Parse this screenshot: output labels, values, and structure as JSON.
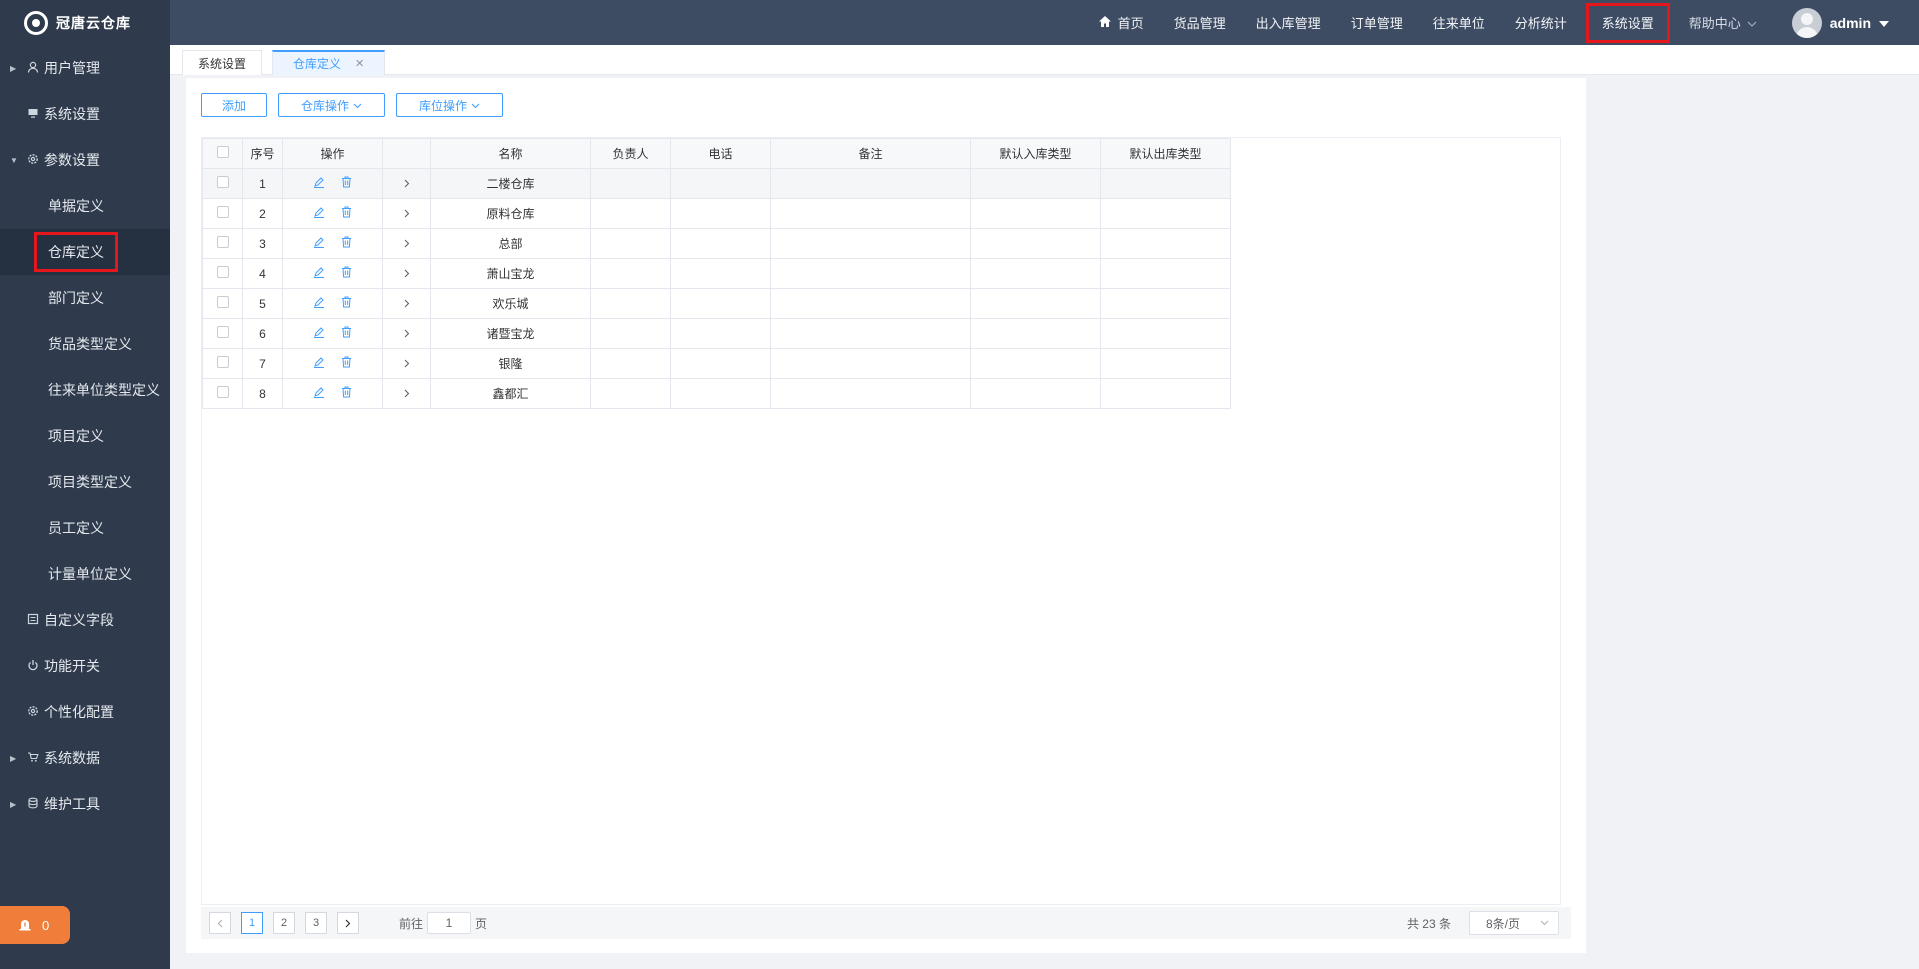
{
  "app": {
    "logo_text": "冠唐云仓库"
  },
  "sidebar": {
    "items": [
      {
        "label": "用户管理",
        "icon": "user-icon",
        "arrow": "collapsed"
      },
      {
        "label": "系统设置",
        "icon": "monitor-icon"
      },
      {
        "label": "参数设置",
        "icon": "gear-icon",
        "arrow": "expanded"
      },
      {
        "label": "单据定义"
      },
      {
        "label": "仓库定义",
        "active": true
      },
      {
        "label": "部门定义"
      },
      {
        "label": "货品类型定义"
      },
      {
        "label": "往来单位类型定义"
      },
      {
        "label": "项目定义"
      },
      {
        "label": "项目类型定义"
      },
      {
        "label": "员工定义"
      },
      {
        "label": "计量单位定义"
      },
      {
        "label": "自定义字段",
        "icon": "form-icon"
      },
      {
        "label": "功能开关",
        "icon": "power-icon"
      },
      {
        "label": "个性化配置",
        "icon": "gear-icon"
      },
      {
        "label": "系统数据",
        "icon": "cart-icon",
        "arrow": "collapsed"
      },
      {
        "label": "维护工具",
        "icon": "database-icon",
        "arrow": "collapsed"
      }
    ],
    "alarm_count": "0"
  },
  "topnav": {
    "items": [
      "首页",
      "货品管理",
      "出入库管理",
      "订单管理",
      "往来单位",
      "分析统计",
      "系统设置",
      "帮助中心"
    ],
    "user": "admin"
  },
  "tabs": [
    "系统设置",
    "仓库定义"
  ],
  "toolbar": {
    "add": "添加",
    "warehouse_ops": "仓库操作",
    "location_ops": "库位操作"
  },
  "table": {
    "headers": [
      "序号",
      "操作",
      "名称",
      "负责人",
      "电话",
      "备注",
      "默认入库类型",
      "默认出库类型"
    ],
    "rows": [
      {
        "no": "1",
        "name": "二楼仓库"
      },
      {
        "no": "2",
        "name": "原料仓库"
      },
      {
        "no": "3",
        "name": "总部"
      },
      {
        "no": "4",
        "name": "萧山宝龙"
      },
      {
        "no": "5",
        "name": "欢乐城"
      },
      {
        "no": "6",
        "name": "诸暨宝龙"
      },
      {
        "no": "7",
        "name": "银隆"
      },
      {
        "no": "8",
        "name": "鑫都汇"
      }
    ]
  },
  "pagination": {
    "pages": [
      "1",
      "2",
      "3"
    ],
    "current": "1",
    "goto_prefix": "前往",
    "goto_value": "1",
    "goto_suffix": "页",
    "total": "共 23 条",
    "page_size": "8条/页"
  },
  "colors": {
    "accent": "#409eff",
    "sidebar_bg": "#2f3b4c",
    "topbar_bg": "#3d4c63",
    "highlight": "#e5171d"
  }
}
